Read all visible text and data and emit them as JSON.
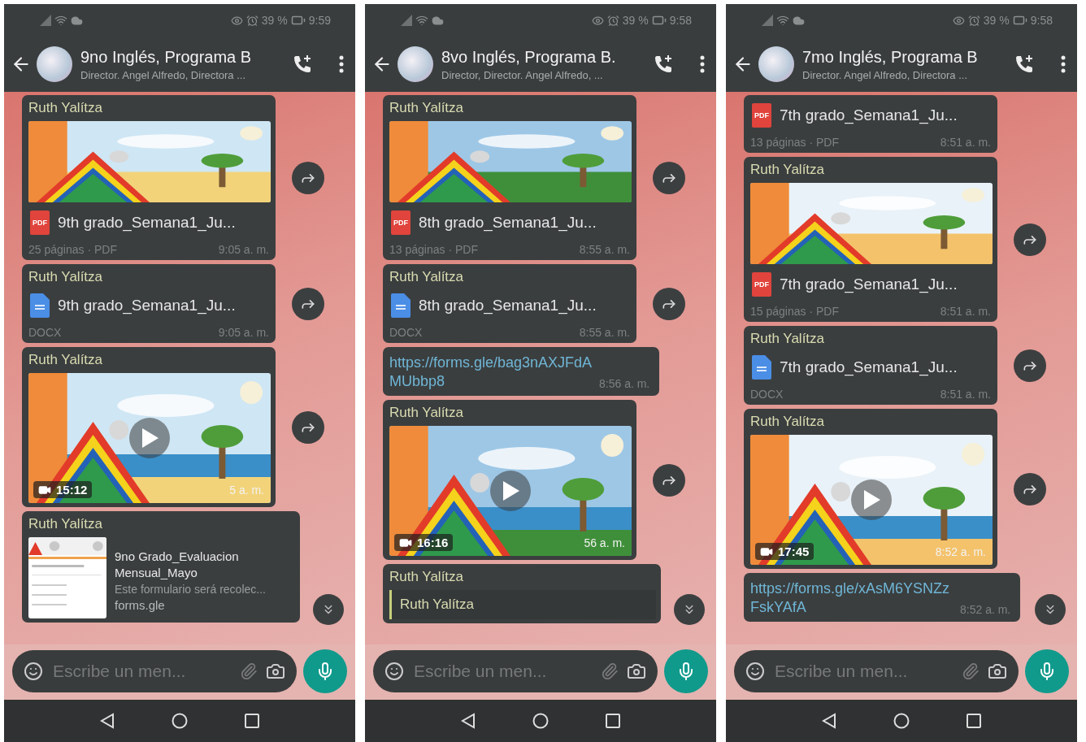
{
  "phones": [
    {
      "status": {
        "battery": "39 %",
        "time": "9:59"
      },
      "header": {
        "title": "9no Inglés, Programa B",
        "subtitle": "Director. Angel Alfredo, Directora ..."
      },
      "messages": [
        {
          "kind": "document",
          "sender": "Ruth Yalítza",
          "preview": true,
          "file_icon": {
            "kind": "pdf",
            "label": "PDF"
          },
          "file_name": "9th grado_Semana1_Ju...",
          "meta": "25 páginas · PDF",
          "time": "9:05 a. m.",
          "forward": true
        },
        {
          "kind": "document",
          "sender": "Ruth Yalítza",
          "preview": false,
          "file_icon": {
            "kind": "docx"
          },
          "file_name": "9th grado_Semana1_Ju...",
          "meta": "DOCX",
          "time": "9:05 a. m.",
          "forward": true
        },
        {
          "kind": "video",
          "sender": "Ruth Yalítza",
          "duration": "15:12",
          "time": "5 a. m.",
          "forward": true
        },
        {
          "kind": "form",
          "sender": "Ruth Yalítza",
          "title": "9no Grado_Evaluacion Mensual_Mayo",
          "description": "Este formulario será recolec...",
          "domain": "forms.gle",
          "forward": false
        }
      ],
      "composer": {
        "placeholder": "Escribe un men..."
      }
    },
    {
      "status": {
        "battery": "39 %",
        "time": "9:58"
      },
      "header": {
        "title": "8vo Inglés, Programa B.",
        "subtitle": "Director, Director. Angel Alfredo, ..."
      },
      "messages": [
        {
          "kind": "document",
          "sender": "Ruth Yalítza",
          "preview": true,
          "file_icon": {
            "kind": "pdf",
            "label": "PDF"
          },
          "file_name": "8th grado_Semana1_Ju...",
          "meta": "13 páginas · PDF",
          "time": "8:55 a. m.",
          "forward": true
        },
        {
          "kind": "document",
          "sender": "Ruth Yalítza",
          "preview": false,
          "file_icon": {
            "kind": "docx"
          },
          "file_name": "8th grado_Semana1_Ju...",
          "meta": "DOCX",
          "time": "8:55 a. m.",
          "forward": true
        },
        {
          "kind": "link",
          "url": "https://forms.gle/bag3nAXJFdAMUbbp8",
          "time": "8:56 a. m.",
          "forward": false
        },
        {
          "kind": "video",
          "sender": "Ruth Yalítza",
          "duration": "16:16",
          "time": "56 a. m.",
          "forward": true
        },
        {
          "kind": "reply",
          "sender": "Ruth Yalítza",
          "quoted": "Ruth Yalítza",
          "forward": false
        }
      ],
      "composer": {
        "placeholder": "Escribe un men..."
      }
    },
    {
      "status": {
        "battery": "39 %",
        "time": "9:58"
      },
      "header": {
        "title": "7mo Inglés, Programa B",
        "subtitle": "Director. Angel Alfredo, Directora ..."
      },
      "messages": [
        {
          "kind": "document",
          "preview": false,
          "file_icon": {
            "kind": "pdf",
            "label": "PDF"
          },
          "file_name": "7th grado_Semana1_Ju...",
          "meta": "13 páginas · PDF",
          "time": "8:51 a. m.",
          "forward": false
        },
        {
          "kind": "document",
          "sender": "Ruth Yalítza",
          "preview": true,
          "file_icon": {
            "kind": "pdf",
            "label": "PDF"
          },
          "file_name": "7th grado_Semana1_Ju...",
          "meta": "15 páginas · PDF",
          "time": "8:51 a. m.",
          "forward": true
        },
        {
          "kind": "document",
          "sender": "Ruth Yalítza",
          "preview": false,
          "file_icon": {
            "kind": "docx"
          },
          "file_name": "7th grado_Semana1_Ju...",
          "meta": "DOCX",
          "time": "8:51 a. m.",
          "forward": true
        },
        {
          "kind": "video",
          "sender": "Ruth Yalítza",
          "duration": "17:45",
          "time": "8:52 a. m.",
          "forward": true
        },
        {
          "kind": "link",
          "url": "https://forms.gle/xAsM6YSNZzFskYAfA",
          "time": "8:52 a. m.",
          "forward": false
        }
      ],
      "composer": {
        "placeholder": "Escribe un men..."
      }
    }
  ]
}
